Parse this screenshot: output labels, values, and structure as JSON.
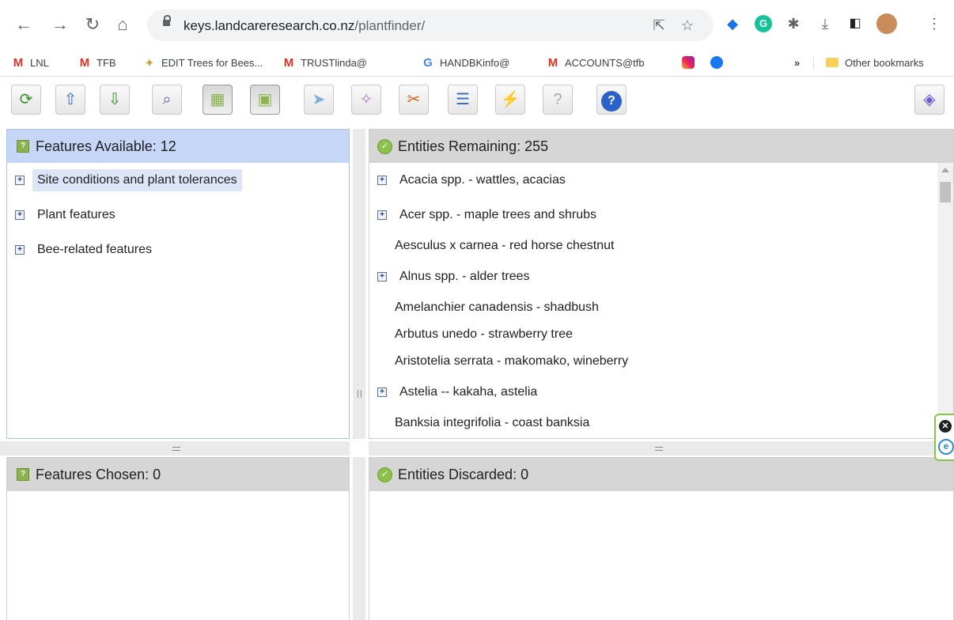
{
  "browser": {
    "url_domain": "keys.landcareresearch.co.nz",
    "url_path": "/plantfinder/",
    "bookmarks": [
      {
        "icon": "gmail-icon",
        "label": "LNL"
      },
      {
        "icon": "gmail-icon",
        "label": "TFB"
      },
      {
        "icon": "bee-icon",
        "label": "EDIT Trees for Bees..."
      },
      {
        "icon": "gmail-icon",
        "label": "TRUSTlinda@"
      },
      {
        "icon": "google-icon",
        "label": "HANDBKinfo@"
      },
      {
        "icon": "gmail-icon",
        "label": "ACCOUNTS@tfb"
      }
    ],
    "overflow_label": "»",
    "other_bookmarks": "Other bookmarks"
  },
  "panels": {
    "features_available": {
      "title": "Features Available: 12",
      "items": [
        {
          "label": "Site conditions and plant tolerances",
          "expandable": true,
          "selected": true
        },
        {
          "label": "Plant features",
          "expandable": true,
          "selected": false
        },
        {
          "label": "Bee-related features",
          "expandable": true,
          "selected": false
        }
      ]
    },
    "entities_remaining": {
      "title": "Entities Remaining: 255",
      "items": [
        {
          "label": "Acacia spp.  -  wattles, acacias",
          "expandable": true
        },
        {
          "label": "Acer spp.  -  maple trees and shrubs",
          "expandable": true
        },
        {
          "label": "Aesculus x carnea  -  red horse chestnut",
          "expandable": false
        },
        {
          "label": "Alnus spp.  -  alder trees",
          "expandable": true
        },
        {
          "label": "Amelanchier canadensis  -  shadbush",
          "expandable": false
        },
        {
          "label": "Arbutus unedo  -  strawberry tree",
          "expandable": false
        },
        {
          "label": "Aristotelia serrata  -  makomako, wineberry",
          "expandable": false
        },
        {
          "label": "Astelia -- kakaha, astelia",
          "expandable": true
        },
        {
          "label": "Banksia integrifolia  -  coast banksia",
          "expandable": false
        }
      ]
    },
    "features_chosen": {
      "title": "Features Chosen: 0"
    },
    "entities_discarded": {
      "title": "Entities Discarded: 0"
    }
  },
  "colors": {
    "panel_header": "#d6d6d6",
    "selected_header": "#c5d6f6",
    "accent_green": "#8bc34a"
  }
}
